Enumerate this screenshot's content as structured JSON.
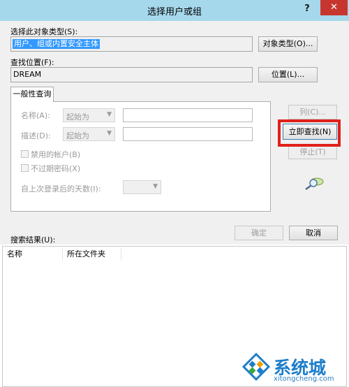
{
  "window": {
    "title": "选择用户或组",
    "help": "?",
    "close": "✕"
  },
  "object_type": {
    "label": "选择此对象类型(S):",
    "value": "用户、组或内置安全主体",
    "button": "对象类型(O)..."
  },
  "location": {
    "label": "查找位置(F):",
    "value": "DREAM",
    "button": "位置(L)..."
  },
  "tab": {
    "label": "一般性查询"
  },
  "query": {
    "name_label": "名称(A):",
    "name_mode": "起始为",
    "desc_label": "描述(D):",
    "desc_mode": "起始为",
    "disabled_accounts": "禁用的帐户(B)",
    "non_expiring_pw": "不过期密码(X)",
    "days_since_login": "自上次登录后的天数(I):"
  },
  "side_buttons": {
    "columns": "列(C)...",
    "find_now": "立即查找(N)",
    "stop": "停止(T)"
  },
  "dialog_buttons": {
    "ok": "确定",
    "cancel": "取消"
  },
  "results": {
    "label": "搜索结果(U):",
    "columns": [
      "名称",
      "所在文件夹"
    ]
  },
  "watermark": {
    "brand": "系统城",
    "url": "xitongcheng.com"
  },
  "colors": {
    "titlebar": "#a6d8ec",
    "close": "#c7362e",
    "highlight": "#e0201a",
    "selection": "#3399ff"
  }
}
